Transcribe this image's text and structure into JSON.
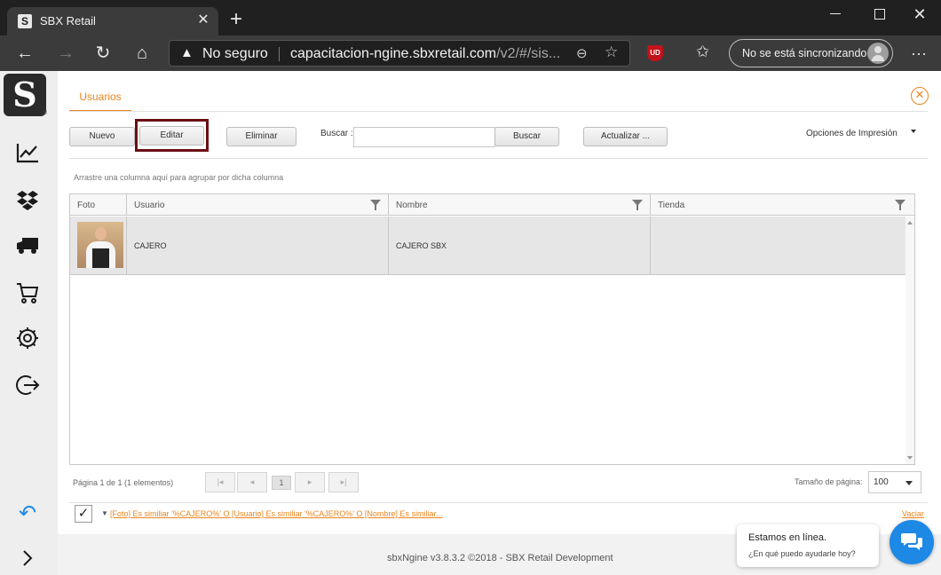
{
  "browser": {
    "tab_title": "SBX Retail",
    "tab_favicon": "S",
    "security_label": "No seguro",
    "url_host": "capacitacion-ngine.sbxretail.com",
    "url_path": "/v2/#/sis...",
    "sync_label": "No se está sincronizando",
    "extension_label": "UD"
  },
  "sidebar": {
    "logo": "S",
    "icons": [
      "chart-icon",
      "dropbox-icon",
      "truck-icon",
      "cart-icon",
      "gear-icon",
      "logout-icon",
      "undo-icon",
      "chevron-right-icon"
    ]
  },
  "main": {
    "tab": "Usuarios",
    "toolbar": {
      "new_label": "Nuevo",
      "edit_label": "Editar",
      "delete_label": "Eliminar",
      "search_label": "Buscar :",
      "search_value": "",
      "search_button": "Buscar",
      "refresh_label": "Actualizar ...",
      "print_options": "Opciones de Impresión"
    },
    "group_hint": "Arrastre una columna aquí para agrupar por dicha columna",
    "grid": {
      "columns": [
        "Foto",
        "Usuario",
        "Nombre",
        "Tienda"
      ],
      "rows": [
        {
          "usuario": "CAJERO",
          "nombre": "CAJERO SBX",
          "tienda": ""
        }
      ]
    },
    "pager": {
      "summary": "Página 1 de 1 (1 elementos)",
      "current_page": "1",
      "page_size_label": "Tamaño de página:",
      "page_size": "100"
    },
    "filter": {
      "expression": "[Foto] Es similiar '%CAJERO%' O [Usuario] Es similiar '%CAJERO%' O [Nombre] Es similiar...",
      "clear_label": "Vaciar"
    }
  },
  "footer": "sbxNgine v3.8.3.2 ©2018 - SBX Retail Development",
  "chat": {
    "title": "Estamos en línea.",
    "subtitle": "¿En qué puedo ayudarle hoy?"
  },
  "colors": {
    "accent": "#e8851f",
    "highlight_frame": "#6b0e14",
    "chat_button": "#1e88e5"
  }
}
